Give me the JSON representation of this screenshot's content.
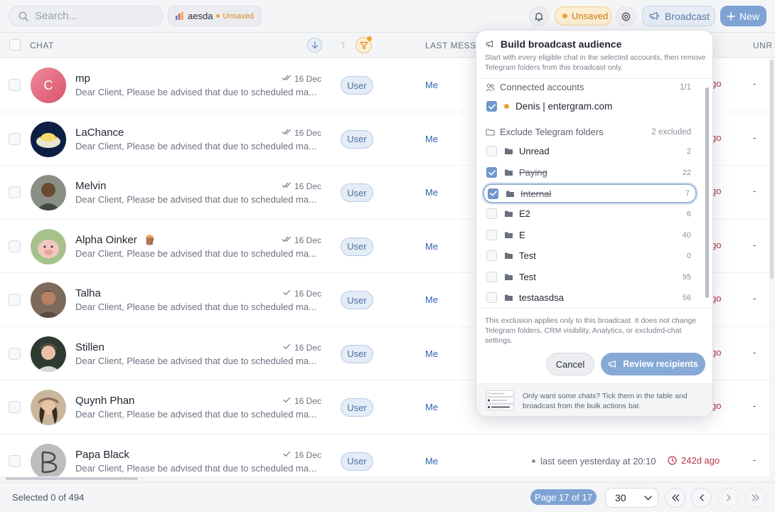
{
  "search": {
    "placeholder": "Search..."
  },
  "view_chip": {
    "name": "aesda",
    "status": "Unsaved"
  },
  "toolbar": {
    "unsaved_label": "Unsaved",
    "broadcast_label": "Broadcast",
    "new_label": "New"
  },
  "table": {
    "headers": {
      "chat": "CHAT",
      "type": "T",
      "last_message": "LAST MESSA",
      "unread": "UNR"
    },
    "rows": [
      {
        "name": "mp",
        "initial": "C",
        "preview": "Dear Client, Please be advised that due to scheduled ma...",
        "date": "16 Dec",
        "type": "User",
        "last_by": "Me",
        "ago": "go",
        "unread": "-"
      },
      {
        "name": "LaChance",
        "preview": "Dear Client, Please be advised that due to scheduled ma...",
        "date": "16 Dec",
        "type": "User",
        "last_by": "Me",
        "ago": "go",
        "unread": "-"
      },
      {
        "name": "Melvin",
        "preview": "Dear Client, Please be advised that due to scheduled ma...",
        "date": "16 Dec",
        "type": "User",
        "last_by": "Me",
        "ago": "go",
        "unread": "-"
      },
      {
        "name": "Alpha Oinker",
        "emoji": "🪵",
        "preview": "Dear Client, Please be advised that due to scheduled ma...",
        "date": "16 Dec",
        "type": "User",
        "last_by": "Me",
        "ago": "go",
        "unread": "-"
      },
      {
        "name": "Talha",
        "preview": "Dear Client, Please be advised that due to scheduled ma...",
        "date": "16 Dec",
        "type": "User",
        "last_by": "Me",
        "ago": "go",
        "unread": "-"
      },
      {
        "name": "Stillen",
        "preview": "Dear Client, Please be advised that due to scheduled ma...",
        "date": "16 Dec",
        "type": "User",
        "last_by": "Me",
        "ago": "go",
        "unread": "-"
      },
      {
        "name": "Quynh Phan",
        "preview": "Dear Client, Please be advised that due to scheduled ma...",
        "date": "16 Dec",
        "type": "User",
        "last_by": "Me",
        "ago": "go",
        "unread": "-"
      },
      {
        "name": "Papa Black",
        "preview": "Dear Client, Please be advised that due to scheduled ma...",
        "date": "16 Dec",
        "type": "User",
        "last_by": "Me",
        "last_seen": "last seen yesterday at 20:10",
        "ago": "242d ago",
        "unread": "-"
      }
    ]
  },
  "footer": {
    "selected": "Selected 0 of 494",
    "page": "Page 17 of 17",
    "page_size": "30"
  },
  "popover": {
    "title": "Build broadcast audience",
    "subtitle": "Start with every eligible chat in the selected accounts, then remove Telegram folders from this broadcast only.",
    "accounts_heading": "Connected accounts",
    "accounts_count": "1/1",
    "account": {
      "label": "Denis | entergram.com",
      "checked": true
    },
    "folders_heading": "Exclude Telegram folders",
    "folders_count": "2 excluded",
    "folders": [
      {
        "label": "Unread",
        "count": "2",
        "checked": false
      },
      {
        "label": "Paying",
        "count": "22",
        "checked": true
      },
      {
        "label": "Internal",
        "count": "7",
        "checked": true
      },
      {
        "label": "E2",
        "count": "6",
        "checked": false
      },
      {
        "label": "E",
        "count": "40",
        "checked": false
      },
      {
        "label": "Test",
        "count": "0",
        "checked": false
      },
      {
        "label": "Test",
        "count": "95",
        "checked": false
      },
      {
        "label": "testaasdsa",
        "count": "56",
        "checked": false
      }
    ],
    "note": "This exclusion applies only to this broadcast. It does not change Telegram folders, CRM visibility, Analytics, or excluded-chat settings.",
    "cancel_label": "Cancel",
    "review_label": "Review recipients",
    "tip": "Only want some chats? Tick them in the table and broadcast from the bulk actions bar."
  },
  "colors": {
    "accent": "#7ea3d3",
    "warning": "#f0a030",
    "danger": "#b8324a"
  }
}
